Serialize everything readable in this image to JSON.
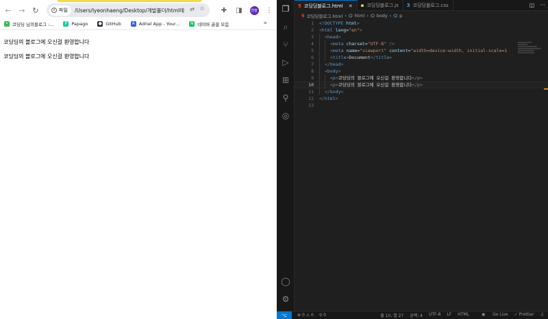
{
  "browser": {
    "back_icon": "arrow-left-icon",
    "forward_icon": "arrow-right-icon",
    "reload_icon": "reload-icon",
    "chip_label": "파일",
    "url": "/Users/lyeonhaeng/Desktop/개발폴더/html테...",
    "profile_initials": "연행",
    "bookmarks": [
      {
        "label": "코딩딩 님의블로그 :...",
        "color": "#3cba54"
      },
      {
        "label": "Papago",
        "color": "#1ec8a5"
      },
      {
        "label": "GitHub",
        "color": "#24292e"
      },
      {
        "label": "Adriel App - Your...",
        "color": "#2f5bea"
      },
      {
        "label": "네이버 글꼴 모음",
        "color": "#03c75a"
      }
    ],
    "page": {
      "paragraphs": [
        "코딩딩의 블로그에 오신걸 환영합니다",
        "코딩딩의 블로그에 오신걸 환영합니다"
      ]
    }
  },
  "vscode": {
    "tabs": [
      {
        "label": "코딩딩블로그.html",
        "kind": "html",
        "active": true
      },
      {
        "label": "코딩딩블로그.js",
        "kind": "js",
        "active": false
      },
      {
        "label": "코딩딩블로그.css",
        "kind": "css",
        "active": false
      }
    ],
    "breadcrumb": {
      "file": "코딩딩블로그.html",
      "items": [
        "html",
        "body",
        "p"
      ]
    },
    "current_line": 10,
    "status": {
      "errors": "0",
      "warnings": "0",
      "ports": "0",
      "position": "줄 10, 열 27",
      "spaces": "공백: 4",
      "encoding": "UTF-8",
      "eol": "LF",
      "language": "HTML",
      "go_live": "Go Live",
      "prettier": "✓ Prettier"
    }
  }
}
